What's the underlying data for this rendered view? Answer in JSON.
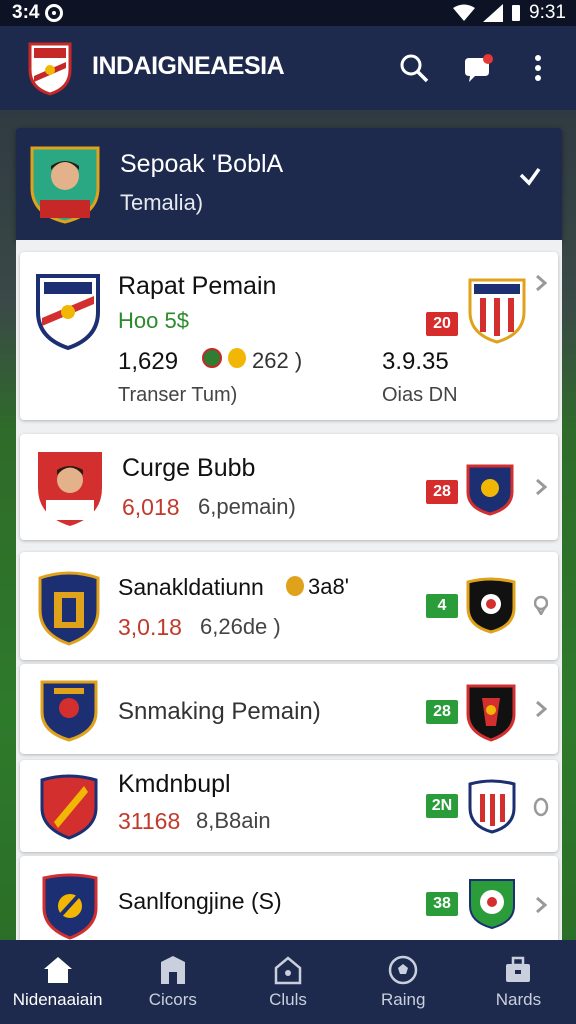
{
  "status_bar": {
    "time_left": "3:4",
    "time_right": "9:31"
  },
  "app_bar": {
    "title": "INDAIGNEAESIA"
  },
  "profile": {
    "name": "Sepoak 'BoblA",
    "subtitle": "Temalia)"
  },
  "cards": [
    {
      "title": "Rapat Pemain",
      "value": "Hoo 5$",
      "stat1": "1,629",
      "stat2": "262 )",
      "label": "Transer Tum)",
      "right_value": "3.9.35",
      "right_label": "Oias DN",
      "badge": "20"
    },
    {
      "title": "Curge Bubb",
      "value": "6,018",
      "value_suffix": "6,pemain)",
      "badge": "28"
    },
    {
      "title": "Sanakldatiunn",
      "title_suffix": "3a8'",
      "value": "3,0.18",
      "value_suffix": "6,26de )",
      "badge": "4"
    },
    {
      "title": "Snmaking Pemain)",
      "badge": "28"
    },
    {
      "title": "Kmdnbupl",
      "value": "31168",
      "value_suffix": "8,B8ain",
      "badge": "2N"
    },
    {
      "title": "Sanlfongjine (S)",
      "badge": "38"
    }
  ],
  "bottom_nav": [
    {
      "label": "Nidenaaiain",
      "icon": "home-icon"
    },
    {
      "label": "Cicors",
      "icon": "building-icon"
    },
    {
      "label": "Cluls",
      "icon": "house-outline-icon"
    },
    {
      "label": "Raing",
      "icon": "soccer-ball-icon"
    },
    {
      "label": "Nards",
      "icon": "briefcase-icon"
    }
  ],
  "colors": {
    "navy": "#1d2a4d",
    "badge_red": "#d62c2c",
    "badge_green": "#2a9c3a",
    "stat_red": "#c0392b",
    "stat_green": "#2b8a2b"
  }
}
